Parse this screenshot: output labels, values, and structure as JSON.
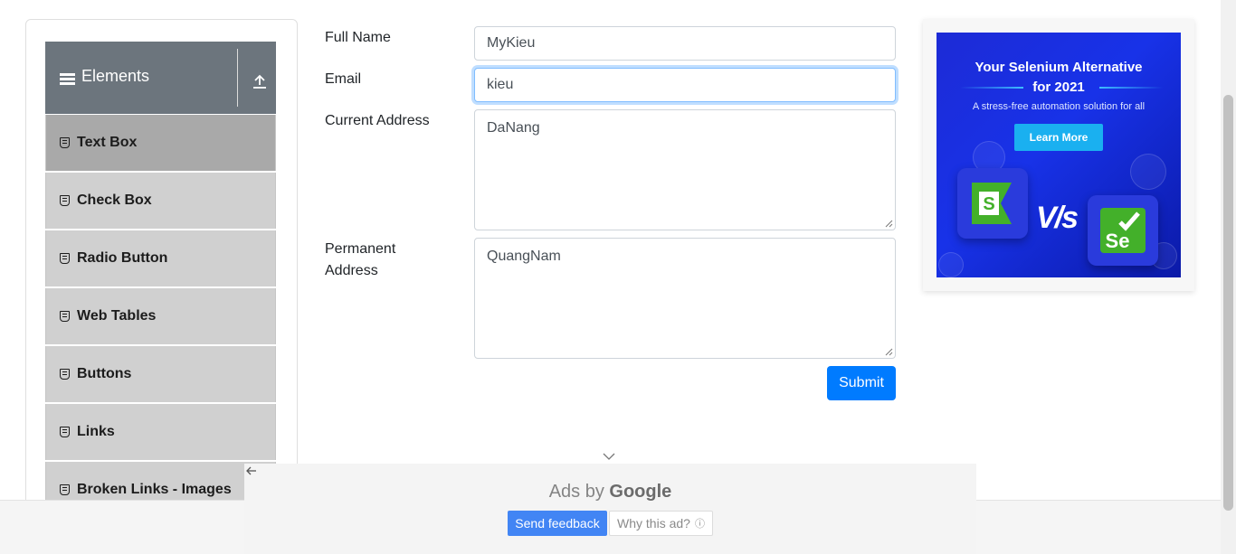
{
  "sidebar": {
    "group_title": "Elements",
    "group_icon": "hamburger-icon",
    "collapse_icon": "upload-icon",
    "items": [
      {
        "label": "Text Box",
        "active": true
      },
      {
        "label": "Check Box"
      },
      {
        "label": "Radio Button"
      },
      {
        "label": "Web Tables"
      },
      {
        "label": "Buttons"
      },
      {
        "label": "Links"
      },
      {
        "label": "Broken Links - Images"
      }
    ]
  },
  "form": {
    "full_name": {
      "label": "Full Name",
      "value": "MyKieu"
    },
    "email": {
      "label": "Email",
      "value": "kieu"
    },
    "current_address": {
      "label": "Current Address",
      "value": "DaNang"
    },
    "permanent_address": {
      "label_line1": "Permanent",
      "label_line2": "Address",
      "value": "QuangNam"
    },
    "submit_label": "Submit"
  },
  "ad": {
    "headline_line1": "Your Selenium Alternative",
    "headline_line2": "for 2021",
    "subtext": "A stress-free automation solution for all",
    "cta": "Learn More",
    "vs_text": "V/s",
    "brand_colors": {
      "background": "#1832e8",
      "cta": "#1ab0f0",
      "selenium_green": "#43b02a"
    }
  },
  "google_ad": {
    "ads_by": "Ads by",
    "google": "Google",
    "send_feedback": "Send feedback",
    "why_this_ad": "Why this ad?",
    "info_symbol": "ⓘ"
  },
  "colors": {
    "primary": "#007bff",
    "sidebar_header": "#6c757d",
    "sidebar_item": "#d0d0d0",
    "sidebar_active": "#a9a9a9"
  }
}
